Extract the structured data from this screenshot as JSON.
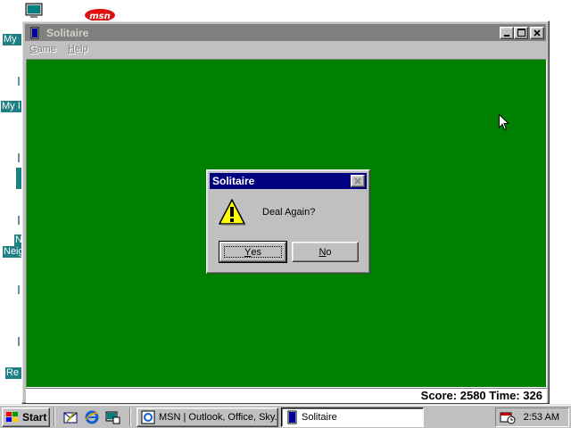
{
  "desktop": {
    "icons": [
      {
        "label": "My"
      },
      {
        "label": "My I"
      },
      {
        "label": "N"
      },
      {
        "label": "Neig"
      },
      {
        "label": "Re"
      }
    ],
    "msn_logo": "msn"
  },
  "window": {
    "title": "Solitaire",
    "menu": [
      {
        "label": "Game",
        "key": "G",
        "rest": "ame"
      },
      {
        "label": "Help",
        "key": "H",
        "rest": "elp"
      }
    ],
    "caption_buttons": {
      "minimize": "_",
      "maximize": "□",
      "close": "×"
    },
    "status": "Score: 2580 Time: 326",
    "felt_color": "#008000"
  },
  "dialog": {
    "title": "Solitaire",
    "message": "Deal Again?",
    "icon": "warning-icon",
    "yes": {
      "key": "Y",
      "rest": "es"
    },
    "no": {
      "key": "N",
      "rest": "o"
    }
  },
  "taskbar": {
    "start": "Start",
    "tasks": [
      {
        "label": "MSN | Outlook, Office, Sky..."
      },
      {
        "label": "Solitaire",
        "active": true
      }
    ],
    "clock": "2:53 AM"
  },
  "colors": {
    "title_active": "#000080",
    "title_inactive": "#808080",
    "desktop_label_bg": "#1e7f84"
  }
}
